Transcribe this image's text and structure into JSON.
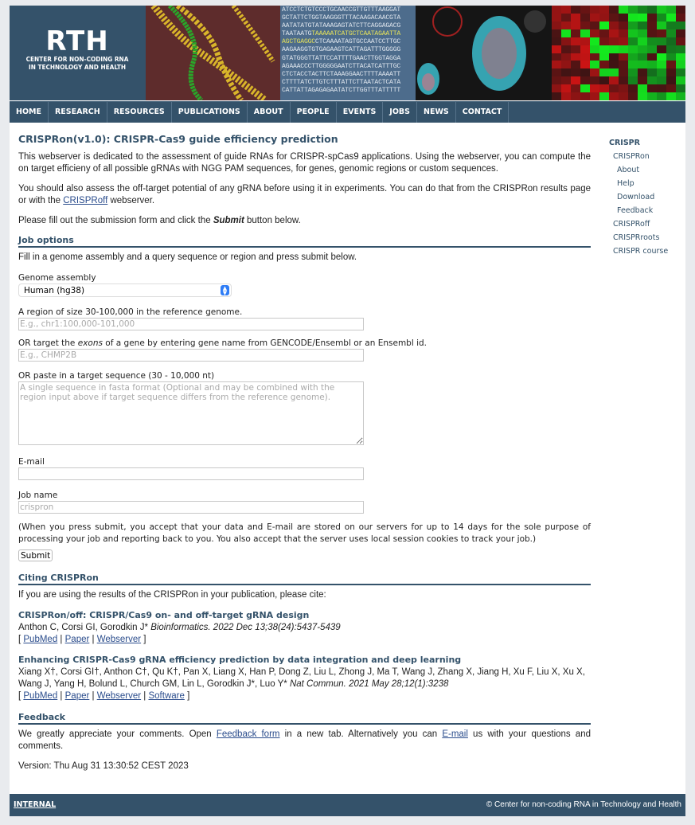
{
  "banner": {
    "logo_big": "RTH",
    "logo_line1": "CENTER FOR NON-CODING RNA",
    "logo_line2": "IN TECHNOLOGY AND HEALTH",
    "sequence_lines": [
      "ATCCTCTGTCCCTGCAACCGTTGTTTAAGGAT",
      "GCTATTCTGGTAAGGGTTTACAAGACAACGTA",
      "AATATATGTATAAAGAGTATCTTCAGGAGACG",
      "TAATAATG|TAAAAATCATGCTCAATAGAATTA",
      "AGCTGAGGC|CTCAAAATAGTGCCAATCCTTGC",
      "AAGAAGGTGTGAGAAGTCATTAGATTTGGGGG",
      "GTATGGGTTATTCCATTTTGAACTTGGTAGGA",
      "AGAAACCCTTGGGGGAATCTTACATCATTTGC",
      "CTCTACCTACTTCTAAAGGAACTTTTAAAATT",
      "CTTTTATCTTGTCTTTATTCTTAATACTCATA",
      "CATTATTAGAGAGAATATCTTGGTTTATTTTT"
    ]
  },
  "nav": [
    "HOME",
    "RESEARCH",
    "RESOURCES",
    "PUBLICATIONS",
    "ABOUT",
    "PEOPLE",
    "EVENTS",
    "JOBS",
    "NEWS",
    "CONTACT"
  ],
  "main": {
    "title": "CRISPRon(v1.0): CRISPR-Cas9 guide efficiency prediction",
    "intro": "This webserver is dedicated to the assessment of guide RNAs for CRISPR-spCas9 applications. Using the webserver, you can compute the on target efficieny of all possible gRNAs with NGG PAM sequences, for genes, genomic regions or custom sequences.",
    "offtarget_pre": "You should also assess the off-target potential of any gRNA before using it in experiments. You can do that from the CRISPRon results page or with the ",
    "offtarget_link": "CRISPRoff",
    "offtarget_post": " webserver.",
    "fill_pre": "Please fill out the submission form and click the ",
    "fill_bold": "Submit",
    "fill_post": " button below.",
    "job_options": {
      "heading": "Job options",
      "desc": "Fill in a genome assembly and a query sequence or region and press submit below.",
      "genome_label": "Genome assembly",
      "genome_value": "Human (hg38)",
      "region_label": "A region of size 30-100,000 in the reference genome.",
      "region_placeholder": "E.g., chr1:100,000-101,000",
      "exons_pre": "OR target the ",
      "exons_em": "exons",
      "exons_post": " of a gene by entering gene name from GENCODE/Ensembl or an Ensembl id.",
      "gene_placeholder": "E.g., CHMP2B",
      "seq_label": "OR paste in a target sequence (30 - 10,000 nt)",
      "seq_placeholder": "A single sequence in fasta format (Optional and may be combined with the region input above if target sequence differs from the reference genome).",
      "email_label": "E-mail",
      "email_value": "",
      "jobname_label": "Job name",
      "jobname_placeholder": "crispron",
      "note": "(When you press submit, you accept that your data and E-mail are stored on our servers for up to 14 days for the sole purpose of processing your job and reporting back to you. You also accept that the server uses local session cookies to track your job.)",
      "submit": "Submit"
    },
    "citing": {
      "heading": "Citing CRISPRon",
      "desc": "If you are using the results of the CRISPRon in your publication, please cite:",
      "refs": [
        {
          "title": "CRISPRon/off: CRISPR/Cas9 on- and off-target gRNA design",
          "authors": "Anthon C, Corsi GI, Gorodkin J* ",
          "journal": "Bioinformatics. 2022 Dec 13;38(24):5437-5439",
          "links": [
            "PubMed",
            "Paper",
            "Webserver"
          ]
        },
        {
          "title": "Enhancing CRISPR-Cas9 gRNA efficiency prediction by data integration and deep learning",
          "authors": "Xiang X†, Corsi GI†, Anthon C†, Qu K†, Pan X, Liang X, Han P, Dong Z, Liu L, Zhong J, Ma T, Wang J, Zhang X, Jiang H, Xu F, Liu X, Xu X, Wang J, Yang H, Bolund L, Church GM, Lin L, Gorodkin J*, Luo Y* ",
          "journal": "Nat Commun. 2021 May 28;12(1):3238",
          "links": [
            "PubMed",
            "Paper",
            "Webserver",
            "Software"
          ]
        }
      ]
    },
    "feedback": {
      "heading": "Feedback",
      "pre": "We greatly appreciate your comments. Open ",
      "link1": "Feedback form",
      "mid": " in a new tab. Alternatively you can ",
      "link2": "E-mail",
      "post": " us with your questions and comments."
    },
    "version": "Version: Thu Aug 31 13:30:52 CEST 2023"
  },
  "sidebar": {
    "heading": "CRISPR",
    "items": [
      {
        "label": "CRISPRon",
        "level": 1
      },
      {
        "label": "About",
        "level": 2
      },
      {
        "label": "Help",
        "level": 2
      },
      {
        "label": "Download",
        "level": 2
      },
      {
        "label": "Feedback",
        "level": 2
      },
      {
        "label": "CRISPRoff",
        "level": 1
      },
      {
        "label": "CRISPRroots",
        "level": 1
      },
      {
        "label": "CRISPR course",
        "level": 1
      }
    ]
  },
  "footer": {
    "internal": "INTERNAL",
    "copyright": "© Center for non-coding RNA in Technology and Health"
  },
  "colors": {
    "brand": "#34526a",
    "link": "#2a4c8c",
    "background": "#e9ebee"
  }
}
